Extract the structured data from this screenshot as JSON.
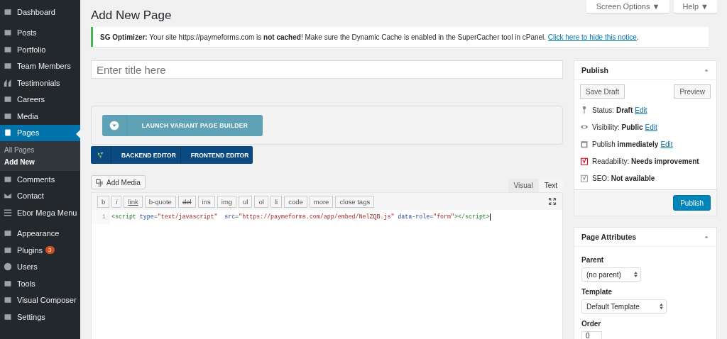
{
  "sidebar": {
    "groups": [
      [
        {
          "label": "Dashboard",
          "selected": false
        }
      ],
      [
        {
          "label": "Posts",
          "selected": false
        },
        {
          "label": "Portfolio",
          "selected": false
        },
        {
          "label": "Team Members",
          "selected": false
        },
        {
          "label": "Testimonials",
          "selected": false
        },
        {
          "label": "Careers",
          "selected": false
        },
        {
          "label": "Media",
          "selected": false
        },
        {
          "label": "Pages",
          "selected": true,
          "children": [
            {
              "label": "All Pages",
              "selected": false
            },
            {
              "label": "Add New",
              "selected": true
            }
          ]
        },
        {
          "label": "Comments",
          "selected": false
        },
        {
          "label": "Contact",
          "selected": false
        },
        {
          "label": "Ebor Mega Menu",
          "selected": false
        }
      ],
      [
        {
          "label": "Appearance",
          "selected": false
        },
        {
          "label": "Plugins",
          "selected": false,
          "badge": "3"
        },
        {
          "label": "Users",
          "selected": false
        },
        {
          "label": "Tools",
          "selected": false
        },
        {
          "label": "Visual Composer",
          "selected": false
        },
        {
          "label": "Settings",
          "selected": false
        }
      ]
    ]
  },
  "header": {
    "title": "Add New Page",
    "buttons": [
      "Screen Options ▼",
      "Help ▼"
    ]
  },
  "notice": {
    "text": "**SG Optimizer:** Your site https://paymeforms.com is **not cached**! Make sure the Dynamic Cache is enabled in the SuperCacher tool in cPanel.",
    "link": "Click here to hide this notice",
    "end": "."
  },
  "title_field": {
    "placeholder": "Enter title here"
  },
  "page_builder": {
    "button": "LAUNCH VARIANT PAGE BUILDER"
  },
  "composer": {
    "buttons": [
      "BACKEND EDITOR",
      "FRONTEND EDITOR"
    ]
  },
  "editor": {
    "add_media": "Add Media",
    "tabs": [
      {
        "label": "Visual",
        "selected": false
      },
      {
        "label": "Text",
        "selected": true
      }
    ],
    "quicktags": [
      "b",
      "i",
      "link",
      "b-quote",
      "del",
      "ins",
      "img",
      "ul",
      "ol",
      "li",
      "code",
      "more",
      "close tags"
    ],
    "lines": [
      {
        "number": "1",
        "tokens": [
          {
            "kind": "tag",
            "text": "<script"
          },
          {
            "kind": "attr",
            "text": " type"
          },
          {
            "kind": "plain",
            "text": "="
          },
          {
            "kind": "string",
            "text": "\"text/javascript\""
          },
          {
            "kind": "attr",
            "text": "  src"
          },
          {
            "kind": "plain",
            "text": "="
          },
          {
            "kind": "string",
            "text": "\"https://paymeforms.com/app/embed/NelZQB.js\""
          },
          {
            "kind": "attr",
            "text": " data-role"
          },
          {
            "kind": "plain",
            "text": "="
          },
          {
            "kind": "string",
            "text": "\"form\""
          },
          {
            "kind": "tag",
            "text": "></script>"
          }
        ]
      }
    ]
  },
  "publish": {
    "title": "Publish",
    "save_draft": "Save Draft",
    "preview": "Preview",
    "rows": [
      {
        "text": "Status: **Draft**",
        "link": "Edit"
      },
      {
        "text": "Visibility: **Public**",
        "link": "Edit"
      },
      {
        "text": "Publish **immediately**",
        "link": "Edit"
      },
      {
        "text": "Readability: **Needs improvement**"
      },
      {
        "text": "SEO: **Not available**"
      }
    ],
    "button": "Publish"
  },
  "page_attributes": {
    "title": "Page Attributes",
    "parent_label": "Parent",
    "parent_value": "(no parent)",
    "template_label": "Template",
    "template_value": "Default Template",
    "order_label": "Order",
    "order_value": "0"
  }
}
